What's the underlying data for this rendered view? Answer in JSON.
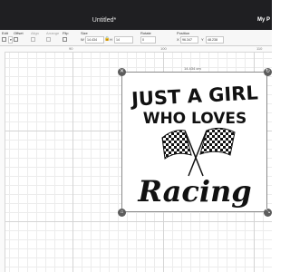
{
  "window": {
    "title": "Untitled*",
    "account": "My P"
  },
  "toolbar": {
    "edit_label": "Edit",
    "offset_label": "Offset",
    "align_label": "Align",
    "arrange_label": "Arrange",
    "flip_label": "Flip",
    "size_label": "Size",
    "width_prefix": "W",
    "width_value": "14.434",
    "height_prefix": "H",
    "height_value": "14",
    "rotate_label": "Rotate",
    "rotate_value": "0",
    "position_label": "Position",
    "x_prefix": "X",
    "x_value": "96.347",
    "y_prefix": "Y",
    "y_value": "48.238"
  },
  "ruler": {
    "marks": [
      "90",
      "100",
      "110"
    ]
  },
  "selection": {
    "width_label": "14.434 cm"
  },
  "artwork": {
    "line1": "JUST A GIRL",
    "line2": "WHO LOVES",
    "line3": "Racing"
  },
  "colors": {
    "titlebar": "#1f1f22",
    "artwork": "#111111",
    "handle": "#5c5c5c"
  }
}
